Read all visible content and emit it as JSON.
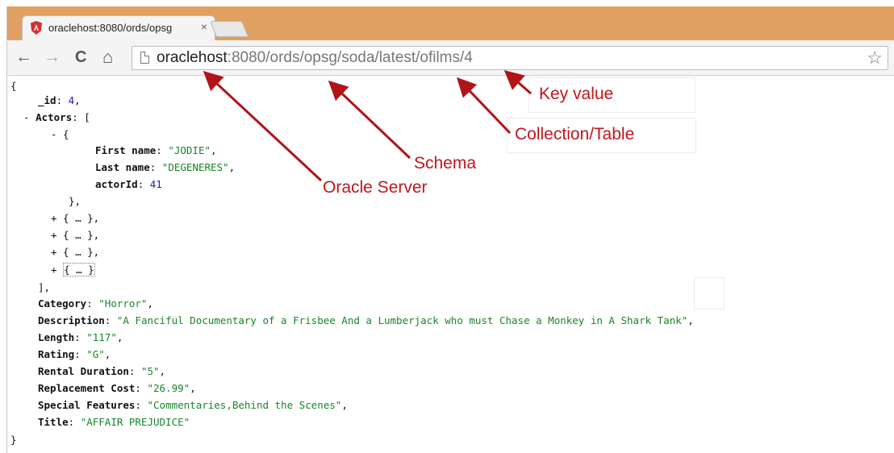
{
  "tab": {
    "title": "oraclehost:8080/ords/opsg",
    "close": "×"
  },
  "toolbar": {
    "back": "←",
    "forward": "→",
    "reload": "C",
    "home": "⌂",
    "star": "☆"
  },
  "url": {
    "host": "oraclehost",
    "rest": ":8080/ords/opsg/soda/latest/ofilms/4"
  },
  "json_lines": [
    {
      "segs": [
        [
          "p",
          "{"
        ]
      ]
    },
    {
      "segs": [
        [
          "k",
          "_id"
        ],
        [
          "p",
          ": "
        ],
        [
          "n",
          "4"
        ],
        [
          "p",
          ","
        ]
      ]
    },
    {
      "segs": [
        [
          "p",
          "- "
        ],
        [
          "k",
          "Actors"
        ],
        [
          "p",
          ": ["
        ]
      ]
    },
    {
      "segs": [
        [
          "p",
          "- {"
        ]
      ]
    },
    {
      "segs": [
        [
          "k",
          "First name"
        ],
        [
          "p",
          ": "
        ],
        [
          "s",
          "\"JODIE\""
        ],
        [
          "p",
          ","
        ]
      ]
    },
    {
      "segs": [
        [
          "k",
          "Last name"
        ],
        [
          "p",
          ": "
        ],
        [
          "s",
          "\"DEGENERES\""
        ],
        [
          "p",
          ","
        ]
      ]
    },
    {
      "segs": [
        [
          "k",
          "actorId"
        ],
        [
          "p",
          ": "
        ],
        [
          "n",
          "41"
        ]
      ]
    },
    {
      "segs": [
        [
          "p",
          "},"
        ]
      ]
    },
    {
      "segs": [
        [
          "p",
          "+ { … },"
        ]
      ]
    },
    {
      "segs": [
        [
          "p",
          "+ { … },"
        ]
      ]
    },
    {
      "segs": [
        [
          "p",
          "+ { … },"
        ]
      ]
    },
    {
      "segs": [
        [
          "p",
          "+ "
        ],
        [
          "b",
          "{ … }"
        ]
      ]
    },
    {
      "segs": [
        [
          "p",
          "],"
        ]
      ]
    },
    {
      "segs": [
        [
          "k",
          "Category"
        ],
        [
          "p",
          ": "
        ],
        [
          "s",
          "\"Horror\""
        ],
        [
          "p",
          ","
        ]
      ]
    },
    {
      "segs": [
        [
          "k",
          "Description"
        ],
        [
          "p",
          ": "
        ],
        [
          "s",
          "\"A Fanciful Documentary of a Frisbee And a Lumberjack who must Chase a Monkey in A Shark Tank\""
        ],
        [
          "p",
          ","
        ]
      ]
    },
    {
      "segs": [
        [
          "k",
          "Length"
        ],
        [
          "p",
          ": "
        ],
        [
          "s",
          "\"117\""
        ],
        [
          "p",
          ","
        ]
      ]
    },
    {
      "segs": [
        [
          "k",
          "Rating"
        ],
        [
          "p",
          ": "
        ],
        [
          "s",
          "\"G\""
        ],
        [
          "p",
          ","
        ]
      ]
    },
    {
      "segs": [
        [
          "k",
          "Rental Duration"
        ],
        [
          "p",
          ": "
        ],
        [
          "s",
          "\"5\""
        ],
        [
          "p",
          ","
        ]
      ]
    },
    {
      "segs": [
        [
          "k",
          "Replacement Cost"
        ],
        [
          "p",
          ": "
        ],
        [
          "s",
          "\"26.99\""
        ],
        [
          "p",
          ","
        ]
      ]
    },
    {
      "segs": [
        [
          "k",
          "Special Features"
        ],
        [
          "p",
          ": "
        ],
        [
          "s",
          "\"Commentaries,Behind the Scenes\""
        ],
        [
          "p",
          ","
        ]
      ]
    },
    {
      "segs": [
        [
          "k",
          "Title"
        ],
        [
          "p",
          ": "
        ],
        [
          "s",
          "\"AFFAIR PREJUDICE\""
        ]
      ]
    },
    {
      "segs": [
        [
          "p",
          "}"
        ]
      ]
    }
  ],
  "annotations": {
    "key_value": "Key value",
    "collection": "Collection/Table",
    "schema": "Schema",
    "server": "Oracle Server"
  },
  "colors": {
    "tabbar": "#e0a062",
    "annotation": "#c0161c",
    "string": "#18852b",
    "number": "#1a1acb"
  }
}
